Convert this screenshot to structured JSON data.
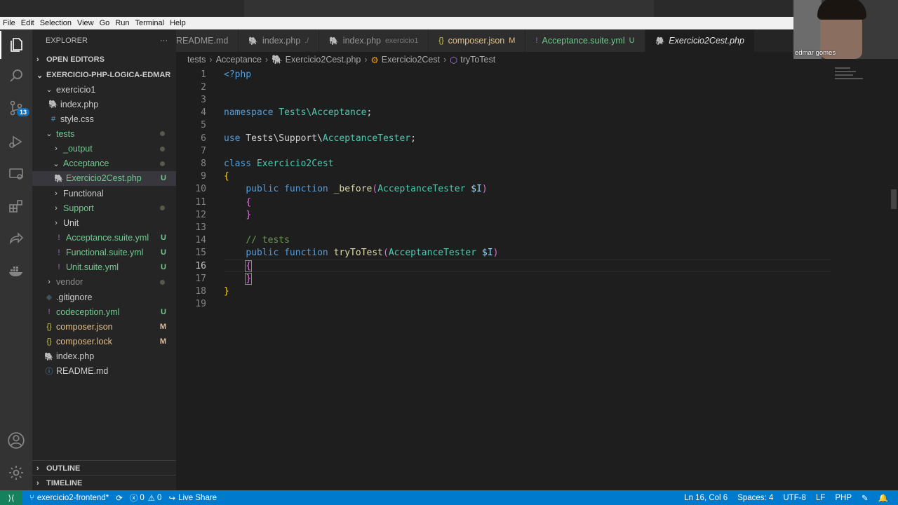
{
  "menu": [
    "File",
    "Edit",
    "Selection",
    "View",
    "Go",
    "Run",
    "Terminal",
    "Help"
  ],
  "activity": {
    "source_control_badge": "13"
  },
  "explorer": {
    "title": "EXPLORER",
    "more": "···",
    "open_editors": "OPEN EDITORS",
    "project": "EXERCICIO-PHP-LOGICA-EDMAR",
    "outline": "OUTLINE",
    "timeline": "TIMELINE",
    "tree": [
      {
        "label": "exercicio1",
        "status": ""
      },
      {
        "label": "index.php",
        "status": ""
      },
      {
        "label": "style.css",
        "status": ""
      },
      {
        "label": "tests",
        "status": ""
      },
      {
        "label": "_output",
        "status": ""
      },
      {
        "label": "Acceptance",
        "status": ""
      },
      {
        "label": "Exercicio2Cest.php",
        "status": "U"
      },
      {
        "label": "Functional",
        "status": ""
      },
      {
        "label": "Support",
        "status": ""
      },
      {
        "label": "Unit",
        "status": ""
      },
      {
        "label": "Acceptance.suite.yml",
        "status": "U"
      },
      {
        "label": "Functional.suite.yml",
        "status": "U"
      },
      {
        "label": "Unit.suite.yml",
        "status": "U"
      },
      {
        "label": "vendor",
        "status": ""
      },
      {
        "label": ".gitignore",
        "status": ""
      },
      {
        "label": "codeception.yml",
        "status": "U"
      },
      {
        "label": "composer.json",
        "status": "M"
      },
      {
        "label": "composer.lock",
        "status": "M"
      },
      {
        "label": "index.php",
        "status": ""
      },
      {
        "label": "README.md",
        "status": ""
      }
    ]
  },
  "tabs": [
    {
      "label": "README.md",
      "sub": "",
      "status": ""
    },
    {
      "label": "index.php",
      "sub": "./",
      "status": ""
    },
    {
      "label": "index.php",
      "sub": "exercicio1",
      "status": ""
    },
    {
      "label": "composer.json",
      "sub": "",
      "status": "M"
    },
    {
      "label": "Acceptance.suite.yml",
      "sub": "",
      "status": "U"
    },
    {
      "label": "Exercicio2Cest.php",
      "sub": "",
      "status": ""
    }
  ],
  "breadcrumbs": [
    "tests",
    "Acceptance",
    "Exercicio2Cest.php",
    "Exercicio2Cest",
    "tryToTest"
  ],
  "editor": {
    "line_numbers": [
      "1",
      "2",
      "3",
      "4",
      "5",
      "6",
      "7",
      "8",
      "9",
      "10",
      "11",
      "12",
      "13",
      "14",
      "15",
      "16",
      "17",
      "18",
      "19"
    ],
    "current_line": "16"
  },
  "webcam": {
    "name": "edmar gomes"
  },
  "status": {
    "branch": "exercicio2-frontend*",
    "errors": "0",
    "warnings": "0",
    "live_share": "Live Share",
    "position": "Ln 16, Col 6",
    "spaces": "Spaces: 4",
    "encoding": "UTF-8",
    "eol": "LF",
    "language": "PHP"
  },
  "colors": {
    "statusbar": "#007acc",
    "sidebar": "#252526",
    "editor": "#1e1e1e",
    "untracked": "#73c991",
    "modified": "#e2c08d"
  }
}
